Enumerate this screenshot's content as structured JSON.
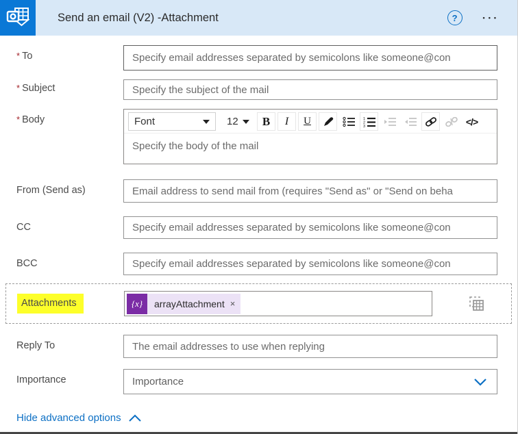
{
  "header": {
    "title": "Send an email (V2) -Attachment",
    "help_label": "?",
    "menu_label": "•••"
  },
  "required_marker": "*",
  "fields": {
    "to": {
      "label": "To",
      "placeholder": "Specify email addresses separated by semicolons like someone@con"
    },
    "subject": {
      "label": "Subject",
      "placeholder": "Specify the subject of the mail"
    },
    "body": {
      "label": "Body",
      "placeholder": "Specify the body of the mail"
    },
    "from": {
      "label": "From (Send as)",
      "placeholder": "Email address to send mail from (requires \"Send as\" or \"Send on beha"
    },
    "cc": {
      "label": "CC",
      "placeholder": "Specify email addresses separated by semicolons like someone@con"
    },
    "bcc": {
      "label": "BCC",
      "placeholder": "Specify email addresses separated by semicolons like someone@con"
    },
    "attachments": {
      "label": "Attachments",
      "token_icon": "{x}",
      "token_label": "arrayAttachment",
      "token_remove": "×"
    },
    "reply_to": {
      "label": "Reply To",
      "placeholder": "The email addresses to use when replying"
    },
    "importance": {
      "label": "Importance",
      "value": "Importance"
    }
  },
  "toolbar": {
    "font_name": "Font",
    "font_size": "12",
    "bold": "B",
    "italic": "I",
    "underline": "U",
    "code": "</>"
  },
  "advanced": {
    "toggle_label": "Hide advanced options"
  },
  "colors": {
    "accent_blue": "#0078d4",
    "header_bg": "#d8e8f7",
    "icon_bg": "#0a78d6",
    "token_purple": "#7b2ca5",
    "token_chip_bg": "#ece2f6",
    "highlight_yellow": "#fdff2a",
    "required_red": "#a4262c"
  }
}
